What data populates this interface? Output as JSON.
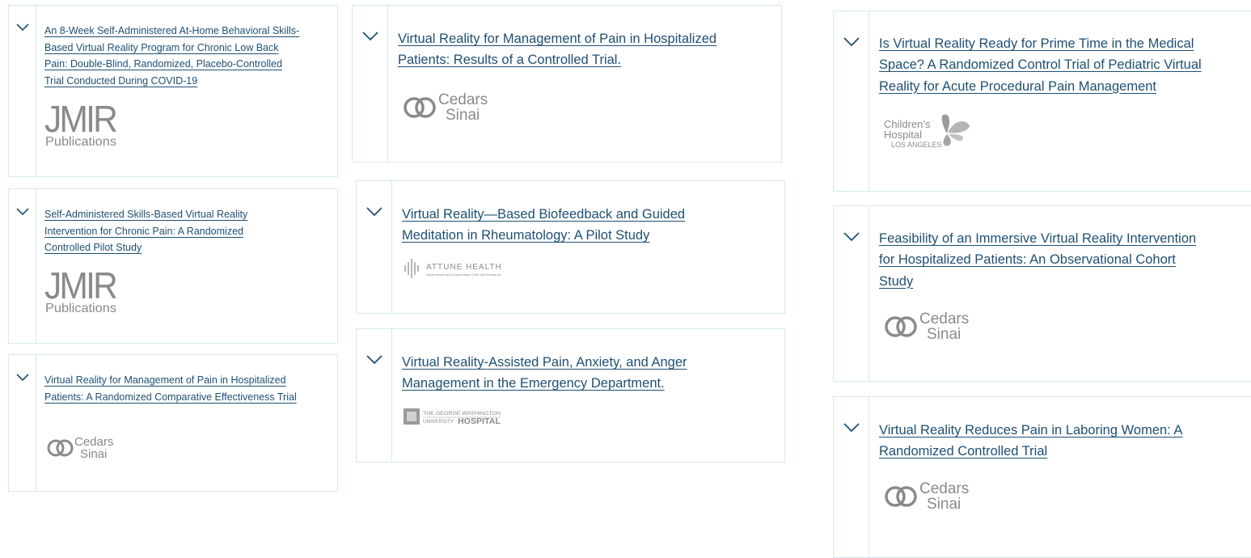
{
  "cards": [
    {
      "title": "An 8-Week Self-Administered At-Home Behavioral Skills-Based Virtual Reality Program for Chronic Low Back Pain: Double-Blind, Randomized, Placebo-Controlled Trial Conducted During COVID-19",
      "logo": "JMIR Publications",
      "logo_line1": "JMIR",
      "logo_line2": "Publications"
    },
    {
      "title": "Self-Administered Skills-Based Virtual Reality Intervention for Chronic Pain: A Randomized Controlled Pilot Study",
      "logo": "JMIR Publications",
      "logo_line1": "JMIR",
      "logo_line2": "Publications"
    },
    {
      "title": "Virtual Reality for Management of Pain in Hospitalized Patients: A Randomized Comparative Effectiveness Trial",
      "logo": "Cedars Sinai",
      "logo_line1": "Cedars",
      "logo_line2": "Sinai"
    },
    {
      "title": "Virtual Reality for Management of Pain in Hospitalized Patients: Results of a Controlled Trial.",
      "logo": "Cedars Sinai",
      "logo_line1": "Cedars",
      "logo_line2": "Sinai"
    },
    {
      "title": "Virtual Reality—Based Biofeedback and Guided Meditation in Rheumatology: A Pilot Study",
      "logo": "Attune Health",
      "logo_line1": "ATTUNE HEALTH",
      "logo_line2": "Autoimmune and Inflammation Care and Research"
    },
    {
      "title": "Virtual Reality-Assisted Pain, Anxiety, and Anger Management in the Emergency Department.",
      "logo": "The George Washington University Hospital",
      "logo_line1": "THE GEORGE WASHINGTON",
      "logo_line2": "UNIVERSITY",
      "logo_line3": "HOSPITAL"
    },
    {
      "title": "Is Virtual Reality Ready for Prime Time in the Medical Space? A Randomized Control Trial of Pediatric Virtual Reality for Acute Procedural Pain Management",
      "logo": "Children's Hospital Los Angeles",
      "logo_line1": "Children's",
      "logo_line2": "Hospital",
      "logo_line3": "LOS ANGELES"
    },
    {
      "title": "Feasibility of an Immersive Virtual Reality Intervention for Hospitalized Patients: An Observational Cohort Study",
      "logo": "Cedars Sinai",
      "logo_line1": "Cedars",
      "logo_line2": "Sinai"
    },
    {
      "title": "Virtual Reality Reduces Pain in Laboring Women: A Randomized Controlled Trial",
      "logo": "Cedars Sinai",
      "logo_line1": "Cedars",
      "logo_line2": "Sinai"
    }
  ],
  "theme": {
    "link_color": "#1f4f73",
    "border_color": "#d6e9ec",
    "logo_gray": "#8a8a8a"
  }
}
